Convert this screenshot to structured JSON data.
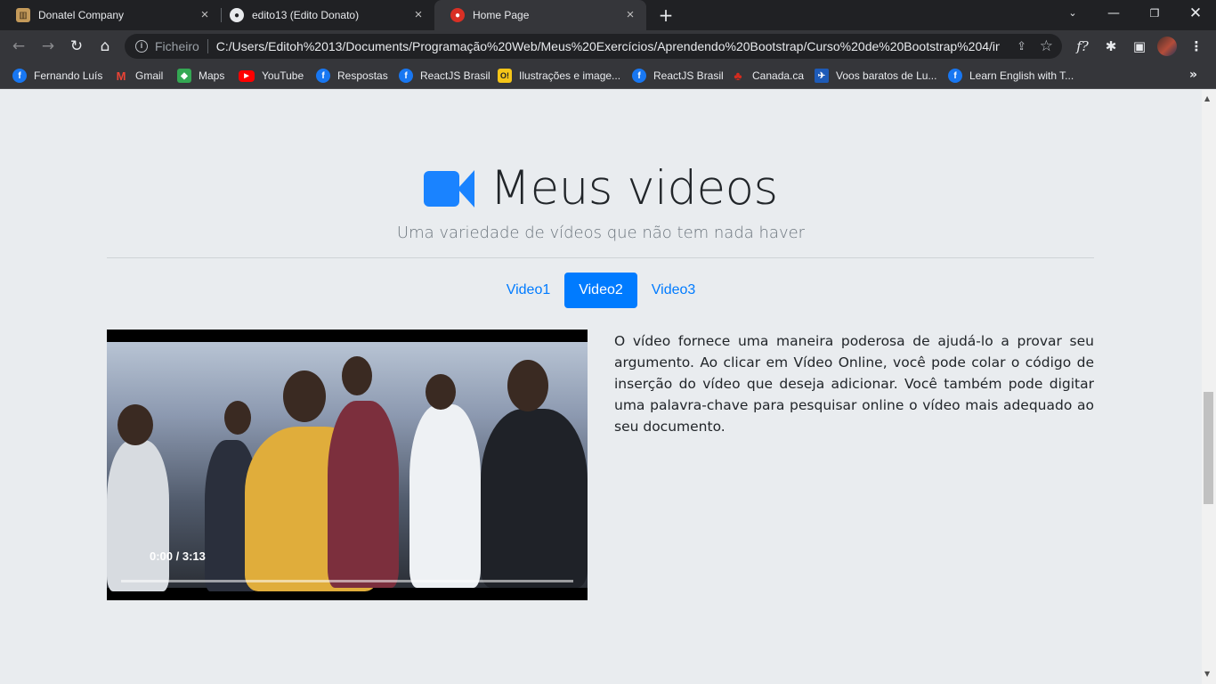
{
  "tabs": [
    {
      "title": "Donatel Company",
      "icon": "donatel-icon",
      "active": false
    },
    {
      "title": "edito13 (Edito Donato)",
      "icon": "github-icon",
      "active": false
    },
    {
      "title": "Home Page",
      "icon": "page-icon",
      "active": true
    }
  ],
  "omnibox": {
    "label": "Ficheiro",
    "url": "C:/Users/Editoh%2013/Documents/Programação%20Web/Meus%20Exercícios/Aprendendo%20Bootstrap/Curso%20de%20Bootstrap%204/in..."
  },
  "bookmarks": [
    {
      "label": "Fernando Luís",
      "icon": "facebook-icon"
    },
    {
      "label": "Gmail",
      "icon": "gmail-icon"
    },
    {
      "label": "Maps",
      "icon": "maps-icon"
    },
    {
      "label": "YouTube",
      "icon": "youtube-icon"
    },
    {
      "label": "Respostas",
      "icon": "facebook-icon"
    },
    {
      "label": "ReactJS Brasil",
      "icon": "facebook-icon"
    },
    {
      "label": "Ilustrações e image...",
      "icon": "o1-icon"
    },
    {
      "label": "ReactJS Brasil",
      "icon": "facebook-icon"
    },
    {
      "label": "Canada.ca",
      "icon": "maple-leaf-icon"
    },
    {
      "label": "Voos baratos de Lu...",
      "icon": "flights-icon"
    },
    {
      "label": "Learn English with T...",
      "icon": "facebook-icon"
    }
  ],
  "page": {
    "title": "Meus videos",
    "subtitle": "Uma variedade de vídeos que não tem nada haver",
    "tabs": [
      "Video1",
      "Video2",
      "Video3"
    ],
    "active_tab": "Video2",
    "video": {
      "time": "0:00 / 3:13"
    },
    "paragraph": "O vídeo fornece uma maneira poderosa de ajudá-lo a provar seu argumento. Ao clicar em Vídeo Online, você pode colar o código de inserção do vídeo que deseja adicionar. Você também pode digitar uma palavra-chave para pesquisar online o vídeo mais adequado ao seu documento."
  },
  "colors": {
    "accent": "#007bff",
    "camera_icon": "#1a83ff",
    "page_bg": "#e9ecef",
    "chrome_dark": "#202124"
  }
}
